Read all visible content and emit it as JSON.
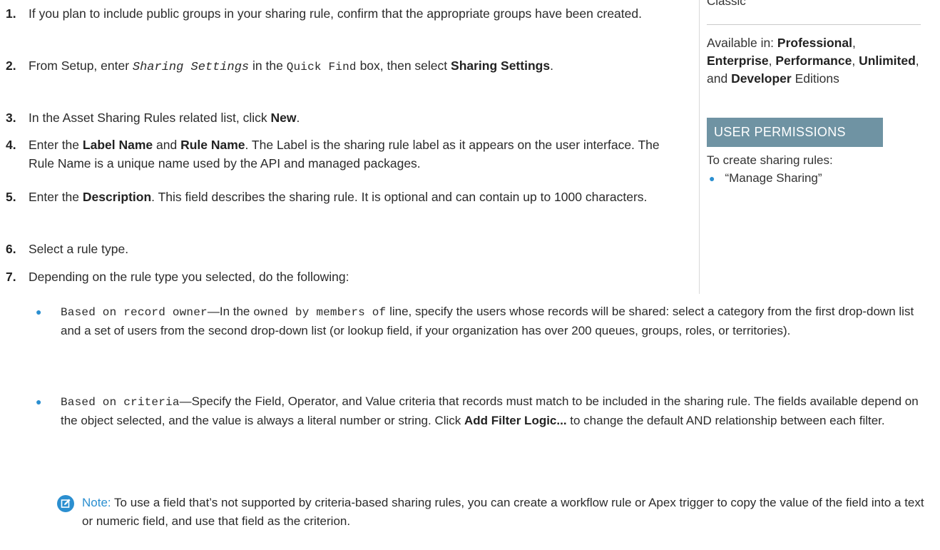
{
  "sidebar": {
    "edition_heading": "Classic",
    "available_prefix": "Available in: ",
    "ed1": "Professional",
    "sep1": ",",
    "ed2": "Enterprise",
    "sep2": ",",
    "ed3": "Performance",
    "sep3": ",",
    "ed4": "Unlimited",
    "sep4": ", and ",
    "ed5": "Developer",
    "available_suffix": "Editions",
    "permissions_title": "USER PERMISSIONS",
    "permissions_desc": "To create sharing rules:",
    "permission_item": "“Manage Sharing”"
  },
  "steps": [
    {
      "num": "1.",
      "text": "If you plan to include public groups in your sharing rule, confirm that the appropriate groups have been created."
    },
    {
      "num": "2.",
      "t1": "From Setup, enter ",
      "code1": "Sharing Settings",
      "t2": " in the ",
      "code2": "Quick Find",
      "t3": " box, then select ",
      "bold1": "Sharing Settings",
      "t4": "."
    },
    {
      "num": "3.",
      "t1": "In the Asset Sharing Rules related list, click ",
      "bold1": "New",
      "t2": "."
    },
    {
      "num": "4.",
      "t1": "Enter the ",
      "bold1": "Label Name",
      "t2": " and ",
      "bold2": "Rule Name",
      "t3": ". The Label is the sharing rule label as it appears on the user interface. The Rule Name is a unique name used by the API and managed packages."
    },
    {
      "num": "5.",
      "t1": "Enter the ",
      "bold1": "Description",
      "t2": ". This field describes the sharing rule. It is optional and can contain up to 1000 characters."
    },
    {
      "num": "6.",
      "text": "Select a rule type."
    },
    {
      "num": "7.",
      "text": "Depending on the rule type you selected, do the following:"
    }
  ],
  "bullets": [
    {
      "code1": "Based on record owner",
      "t1": "—In the ",
      "code2": "owned by members of",
      "t2": " line, specify the users whose records will be shared: select a category from the first drop-down list and a set of users from the second drop-down list (or lookup field, if your organization has over 200 queues, groups, roles, or territories)."
    },
    {
      "code1": "Based on criteria",
      "t1": "—Specify the Field, Operator, and Value criteria that records must match to be included in the sharing rule. The fields available depend on the object selected, and the value is always a literal number or string. Click ",
      "bold1": "Add Filter Logic...",
      "t2": " to change the default AND relationship between each filter."
    }
  ],
  "note": {
    "label": "Note:",
    "text": " To use a field that’s not supported by criteria-based sharing rules, you can create a workflow rule or Apex trigger to copy the value of the field into a text or numeric field, and use that field as the criterion."
  },
  "colors": {
    "accent_blue": "#2b8fd0",
    "permissions_header_bg": "#6f93a3"
  }
}
